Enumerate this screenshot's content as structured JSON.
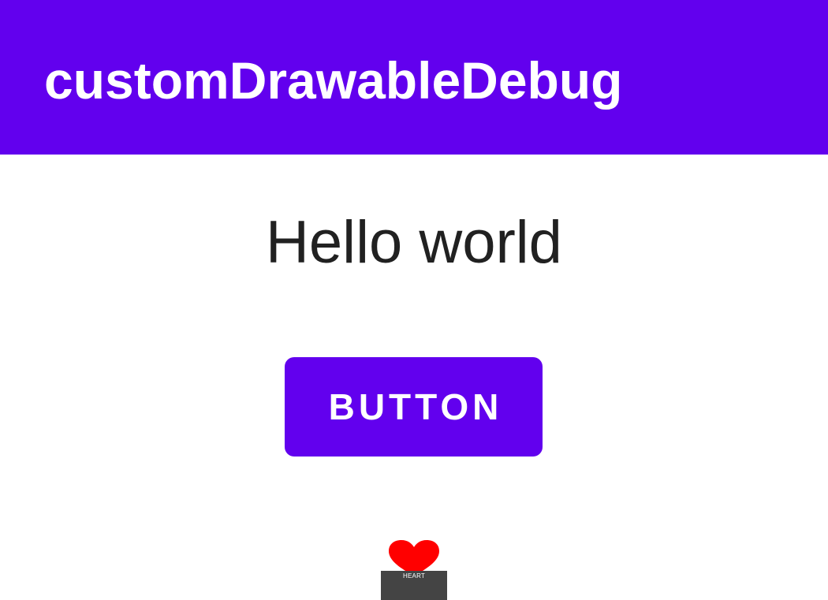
{
  "app_bar": {
    "title": "customDrawableDebug",
    "color": "#6200ee"
  },
  "main": {
    "greeting": "Hello world",
    "button_label": "BUTTON",
    "button_color": "#6200ee",
    "custom_drawable": {
      "icon": "heart-icon",
      "icon_color": "#ff0000",
      "label": "HEART",
      "label_background": "#444444"
    }
  }
}
